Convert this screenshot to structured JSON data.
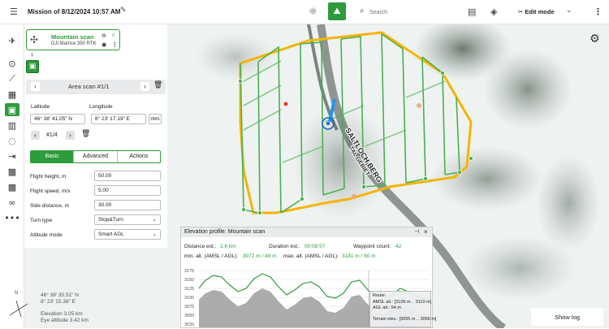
{
  "header": {
    "mission_title": "Mission of 8/12/2024 10:57 AM",
    "search_placeholder": "Search",
    "edit_mode_label": "Edit mode"
  },
  "colors": {
    "accent": "#2e9b3c",
    "route": "#f5b400",
    "flight_path": "#4caf50",
    "panel_bg": "#ffffff"
  },
  "mission_card": {
    "name": "Mountain scan",
    "drone": "DJI Matrice 350 RTK",
    "index": "1"
  },
  "area_scan": {
    "title": "Area scan #1/1",
    "latitude_label": "Latitude",
    "longitude_label": "Longitude",
    "latitude_value": "46° 38' 41.05\" N",
    "longitude_value": "8° 23' 17.19\" E",
    "dms_label": "DMS",
    "point_index": "#1/4",
    "tabs": [
      "Basic",
      "Advanced",
      "Actions"
    ],
    "fields": [
      {
        "label": "Flight height, m",
        "value": "50.00"
      },
      {
        "label": "Flight speed, m/s",
        "value": "5.00"
      },
      {
        "label": "Side distance, m",
        "value": "30.00"
      },
      {
        "label": "Turn type",
        "value": "Stop&Turn"
      },
      {
        "label": "Altitude mode",
        "value": "Smart AGL"
      }
    ]
  },
  "map": {
    "road_label": "SALTLOCH BERG",
    "road_label_2": "TAL GEBIET",
    "coord_lat": "46° 38' 35.51\" N",
    "coord_lon": "8° 23' 15.38\" E",
    "elevation": "Elevation 3.05 km",
    "eye_altitude": "Eye altitude 3.42 km",
    "compass_n": "N",
    "show_log_label": "Show log"
  },
  "elevation_profile": {
    "title": "Elevation profile: Mountain scan",
    "distance_label": "Distance est.:",
    "distance_value": "2.6 km",
    "duration_label": "Duration est.:",
    "duration_value": "00:08:57",
    "waypoint_label": "Waypoint count:",
    "waypoint_value": "42",
    "min_alt_label": "min. alt. (AMSL / AGL):",
    "min_alt_value": "3072 m / 49 m",
    "max_alt_label": "max. alt. (AMSL / AGL):",
    "max_alt_value": "3181 m / 60 m",
    "y_ticks": [
      "3175",
      "3150",
      "3125",
      "3100",
      "3075",
      "3050",
      "3025"
    ],
    "tooltip": {
      "route_label": "Route:",
      "amsl": "AMSL alt.: [3109 m .. 3110 m]",
      "agl": "AGL alt.: 54 m",
      "terrain": "Terrain elev.: [3055 m .. 3056 m]"
    }
  }
}
